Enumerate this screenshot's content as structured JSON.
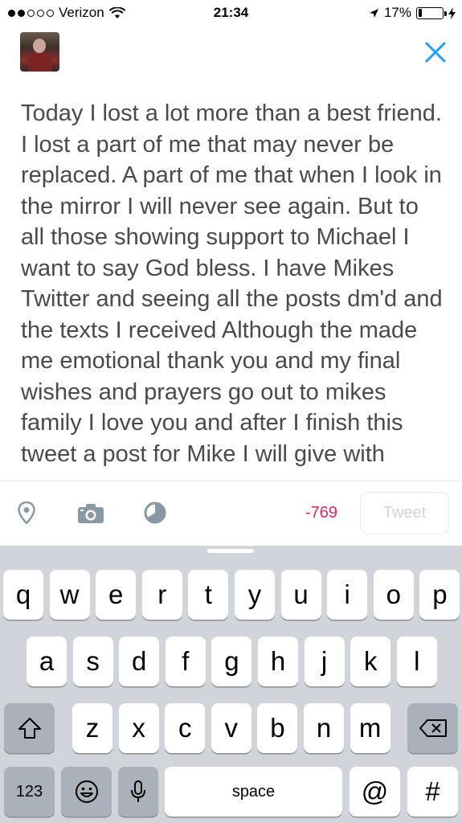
{
  "status_bar": {
    "carrier": "Verizon",
    "time": "21:34",
    "battery": "17%",
    "battery_level": 0.17,
    "icons": [
      "signal-dots",
      "wifi-icon",
      "location-arrow-icon",
      "battery-icon",
      "charging-bolt-icon"
    ]
  },
  "compose": {
    "text": "Today I lost a lot more than a best friend. I lost a part of me that may never be replaced. A part of me that when I look in the mirror I will never see again. But to all those showing support to Michael I want to say God bless. I have Mikes Twitter and seeing all the posts dm'd and the texts I received Although the made me emotional thank you and my final wishes and prayers go out to mikes family I love you and after I finish this tweet a post for Mike I will give with"
  },
  "toolbar": {
    "char_count": "-769",
    "tweet_label": "Tweet",
    "icons": [
      "location-pin-icon",
      "camera-icon",
      "poll-icon"
    ]
  },
  "accent_color": "#1da1f2",
  "keyboard": {
    "row1": [
      "q",
      "w",
      "e",
      "r",
      "t",
      "y",
      "u",
      "i",
      "o",
      "p"
    ],
    "row2": [
      "a",
      "s",
      "d",
      "f",
      "g",
      "h",
      "j",
      "k",
      "l"
    ],
    "row3": [
      "z",
      "x",
      "c",
      "v",
      "b",
      "n",
      "m"
    ],
    "numbers_label": "123",
    "space_label": "space",
    "at_label": "@",
    "hash_label": "#"
  }
}
